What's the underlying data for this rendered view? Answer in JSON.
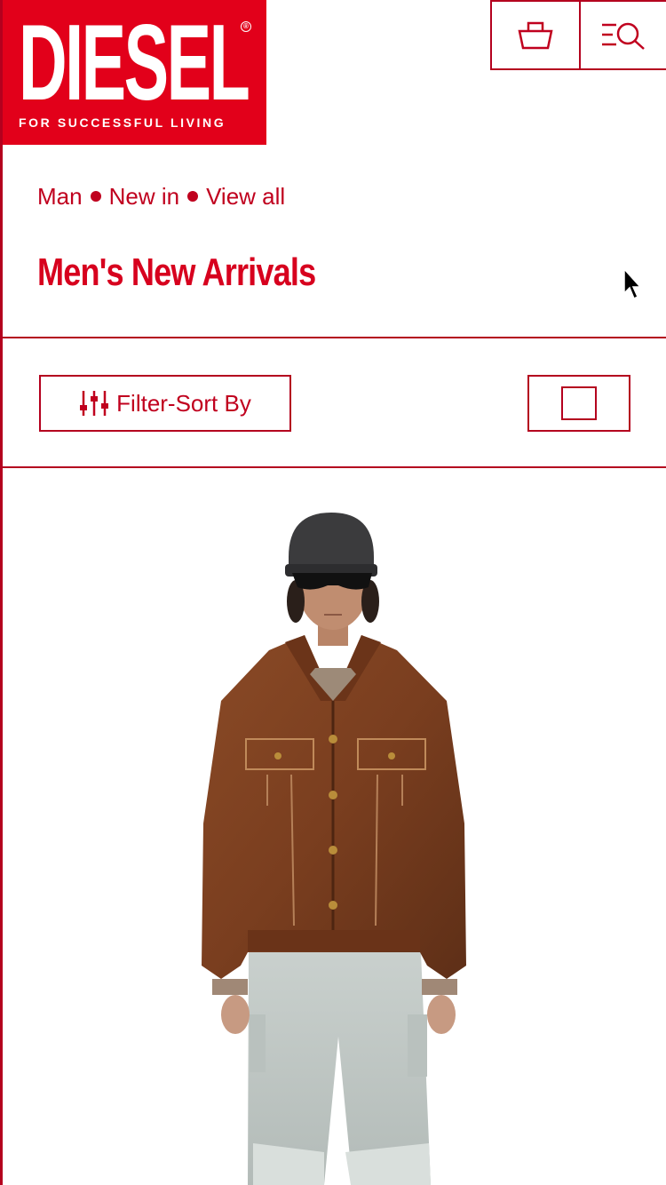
{
  "brand": {
    "logo_text": "DIESEL",
    "tagline": "FOR SUCCESSFUL LIVING",
    "registered": "®",
    "color": "#e2001a"
  },
  "header": {
    "basket_icon": "basket-icon",
    "menu_search_icon": "menu-search-icon"
  },
  "breadcrumb": {
    "items": [
      "Man",
      "New in",
      "View all"
    ]
  },
  "page": {
    "title": "Men's New Arrivals"
  },
  "toolbar": {
    "filter_label": "Filter-Sort By",
    "filter_icon": "sliders-icon",
    "view_toggle_icon": "single-grid-icon"
  },
  "colors": {
    "accent": "#d7001e",
    "border": "#b4001e"
  }
}
